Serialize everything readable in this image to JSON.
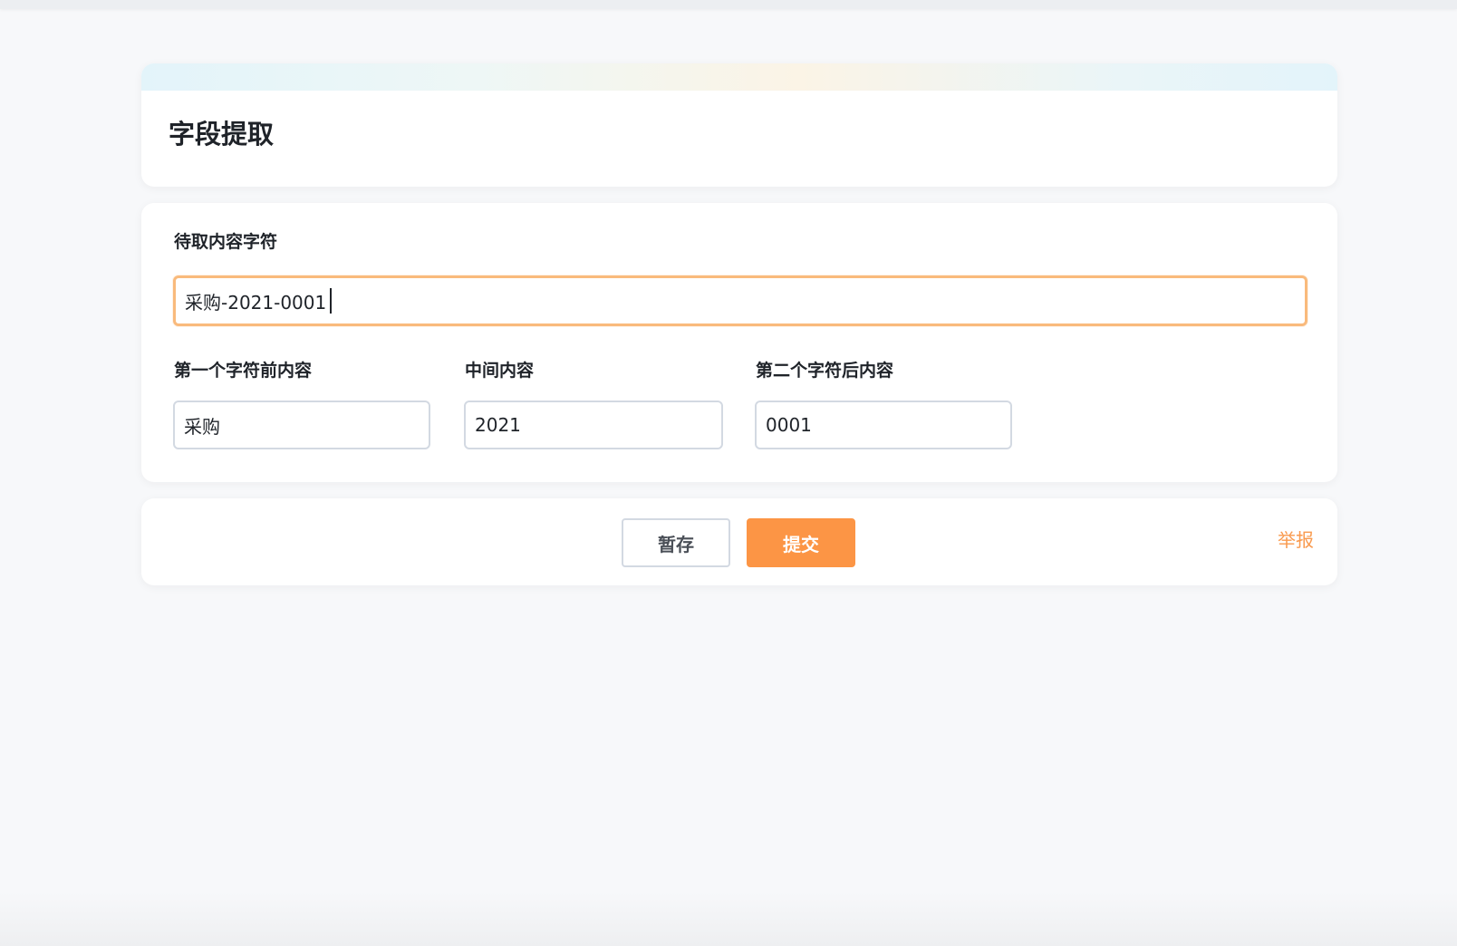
{
  "page": {
    "title": "字段提取"
  },
  "form": {
    "source_label": "待取内容字符",
    "source_value": "采购-2021-0001",
    "first_label": "第一个字符前内容",
    "first_value": "采购",
    "middle_label": "中间内容",
    "middle_value": "2021",
    "last_label": "第二个字符后内容",
    "last_value": "0001"
  },
  "actions": {
    "save_draft_label": "暂存",
    "submit_label": "提交",
    "report_label": "举报"
  },
  "colors": {
    "accent": "#fc9545",
    "focus_border": "#f9ba7c",
    "background": "#f7f8fa"
  }
}
